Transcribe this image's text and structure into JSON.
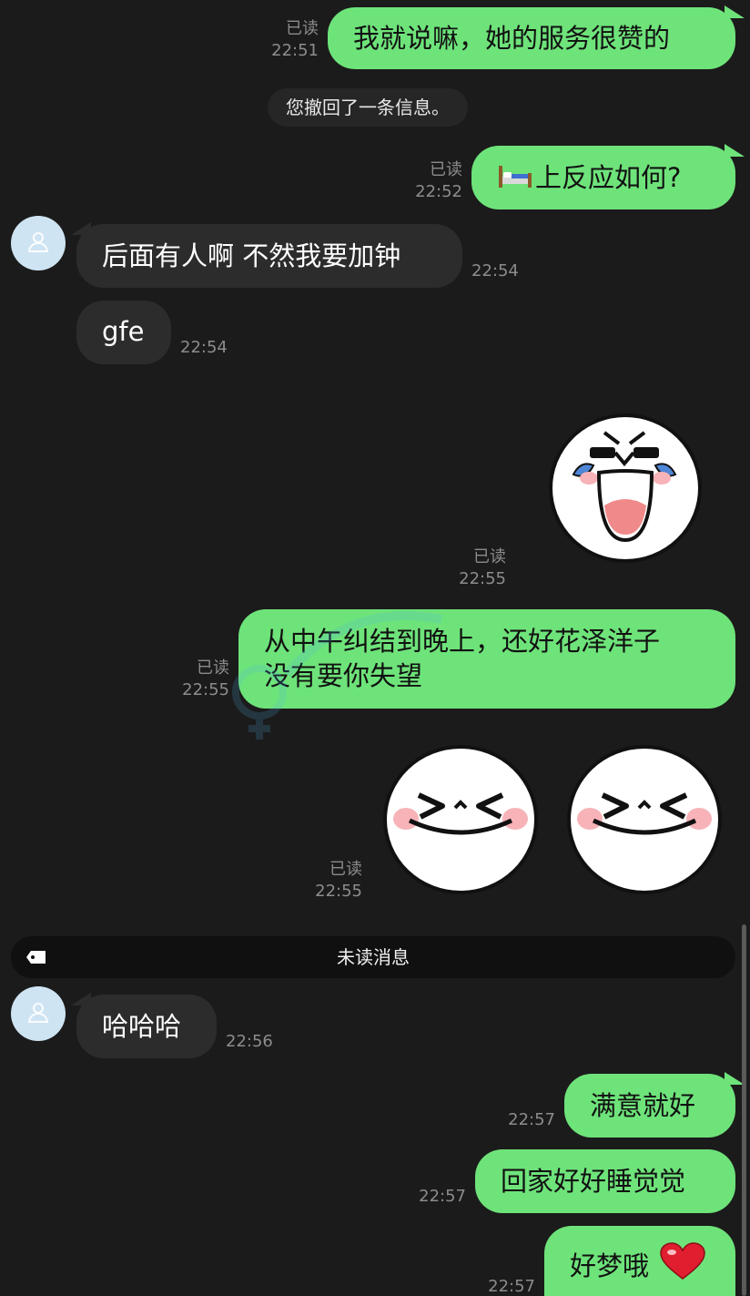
{
  "messages": {
    "m1": {
      "text": "我就说嘛，她的服务很赞的",
      "read": "已读",
      "time": "22:51"
    },
    "recall": {
      "text": "您撤回了一条信息。"
    },
    "m2": {
      "emoji": "🛏️",
      "text": "上反应如何?",
      "read": "已读",
      "time": "22:52"
    },
    "m3": {
      "text": "后面有人啊 不然我要加钟",
      "time": "22:54"
    },
    "m4": {
      "text": "gfe",
      "time": "22:54"
    },
    "m5": {
      "sticker": "laughing-crying-sticker",
      "read": "已读",
      "time": "22:55"
    },
    "m6": {
      "line1": "从中午纠结到晚上，还好花泽洋子",
      "line2": "没有要你失望",
      "read": "已读",
      "time": "22:55"
    },
    "m7": {
      "sticker": "squinting-grin-sticker",
      "read": "已读",
      "time": "22:55"
    },
    "unread": {
      "label": "未读消息"
    },
    "m8": {
      "text": "哈哈哈",
      "time": "22:56"
    },
    "m9": {
      "text": "满意就好",
      "time": "22:57"
    },
    "m10": {
      "text": "回家好好睡觉觉",
      "time": "22:57"
    },
    "m11": {
      "text": "好梦哦",
      "emoji": "❤️",
      "time": "22:57"
    }
  },
  "colors": {
    "background": "#1b1b1b",
    "outgoing_bubble": "#6ee37a",
    "incoming_bubble": "#2c2c2c",
    "meta_text": "#8c8c8c",
    "avatar_bg": "#cfe4f3"
  },
  "icons": {
    "avatar": "user-icon",
    "unread": "tag-icon",
    "heart": "heart-icon",
    "bed": "bed-icon"
  }
}
